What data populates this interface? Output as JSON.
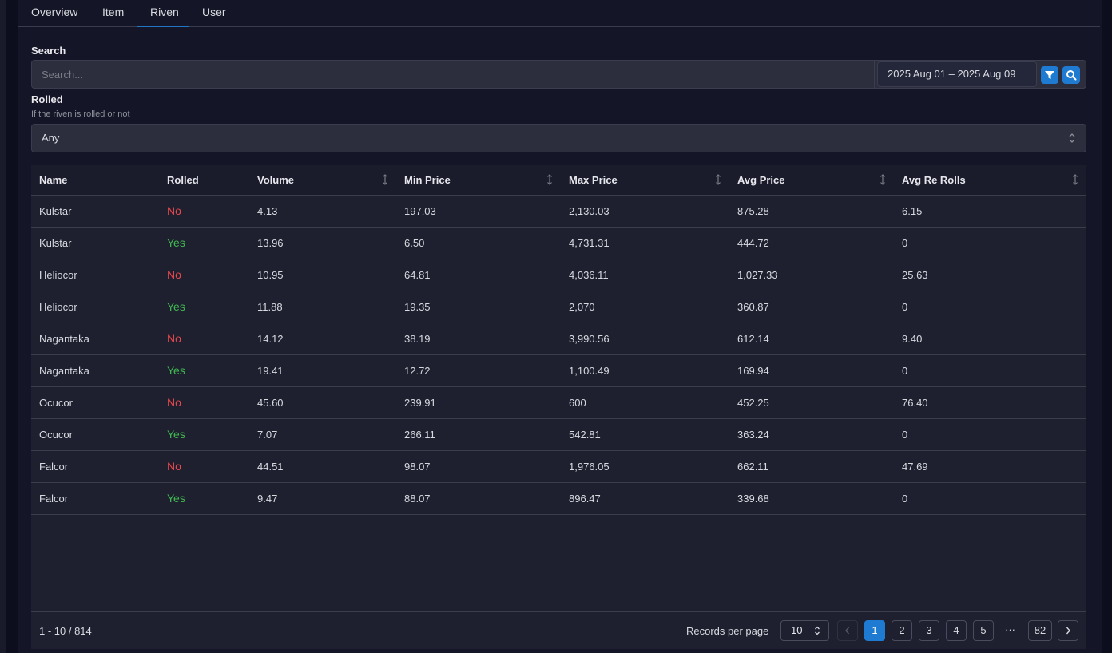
{
  "tabs": [
    {
      "label": "Overview"
    },
    {
      "label": "Item"
    },
    {
      "label": "Riven"
    },
    {
      "label": "User"
    }
  ],
  "active_tab": "Riven",
  "search": {
    "label": "Search",
    "placeholder": "Search...",
    "date_range": "2025 Aug 01 – 2025 Aug 09"
  },
  "rolled_filter": {
    "label": "Rolled",
    "description": "If the riven is rolled or not",
    "value": "Any"
  },
  "table": {
    "columns": [
      "Name",
      "Rolled",
      "Volume",
      "Min Price",
      "Max Price",
      "Avg Price",
      "Avg Re Rolls"
    ],
    "rows": [
      [
        "Kulstar",
        "No",
        "4.13",
        "197.03",
        "2,130.03",
        "875.28",
        "6.15"
      ],
      [
        "Kulstar",
        "Yes",
        "13.96",
        "6.50",
        "4,731.31",
        "444.72",
        "0"
      ],
      [
        "Heliocor",
        "No",
        "10.95",
        "64.81",
        "4,036.11",
        "1,027.33",
        "25.63"
      ],
      [
        "Heliocor",
        "Yes",
        "11.88",
        "19.35",
        "2,070",
        "360.87",
        "0"
      ],
      [
        "Nagantaka",
        "No",
        "14.12",
        "38.19",
        "3,990.56",
        "612.14",
        "9.40"
      ],
      [
        "Nagantaka",
        "Yes",
        "19.41",
        "12.72",
        "1,100.49",
        "169.94",
        "0"
      ],
      [
        "Ocucor",
        "No",
        "45.60",
        "239.91",
        "600",
        "452.25",
        "76.40"
      ],
      [
        "Ocucor",
        "Yes",
        "7.07",
        "266.11",
        "542.81",
        "363.24",
        "0"
      ],
      [
        "Falcor",
        "No",
        "44.51",
        "98.07",
        "1,976.05",
        "662.11",
        "47.69"
      ],
      [
        "Falcor",
        "Yes",
        "9.47",
        "88.07",
        "896.47",
        "339.68",
        "0"
      ]
    ]
  },
  "footer": {
    "count": "1 - 10 / 814",
    "records_per_page_label": "Records per page",
    "records_per_page": "10",
    "pages": [
      "1",
      "2",
      "3",
      "4",
      "5"
    ],
    "ellipsis": "···",
    "last_page": "82",
    "current_page": "1"
  },
  "colors": {
    "accent": "#1e7bd1",
    "no": "#e5484d",
    "yes": "#3fb950"
  }
}
